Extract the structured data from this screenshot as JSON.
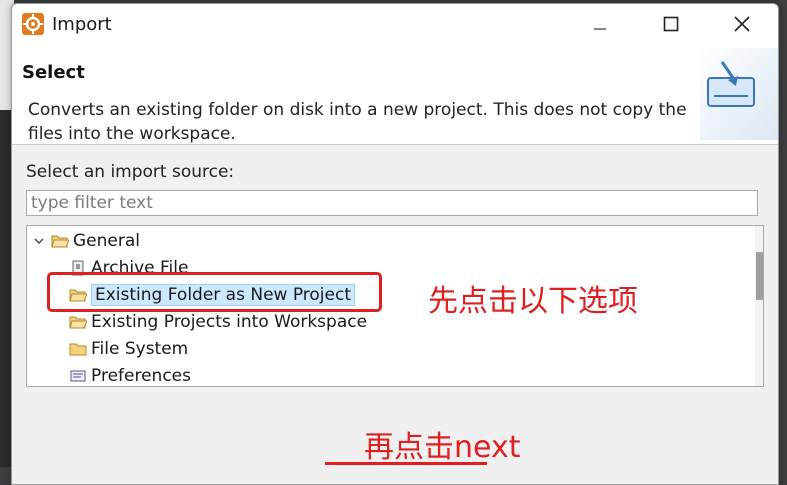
{
  "window": {
    "title": "Import",
    "controls": [
      "minimize",
      "maximize",
      "close"
    ]
  },
  "header": {
    "title": "Select",
    "description": "Converts an existing folder on disk into a new project. This does not copy the files into the workspace."
  },
  "source": {
    "label": "Select an import source:",
    "filter_placeholder": "type filter text",
    "filter_value": ""
  },
  "tree": {
    "group": {
      "label": "General",
      "expanded": true,
      "icon": "open-folder-icon"
    },
    "items": [
      {
        "label": "Archive File",
        "icon": "archive-icon",
        "selected": false
      },
      {
        "label": "Existing Folder as New Project",
        "icon": "open-folder-icon",
        "selected": true
      },
      {
        "label": "Existing Projects into Workspace",
        "icon": "open-folder-icon",
        "selected": false
      },
      {
        "label": "File System",
        "icon": "folder-icon",
        "selected": false
      },
      {
        "label": "Preferences",
        "icon": "preferences-icon",
        "selected": false
      }
    ]
  },
  "annotations": {
    "step1": "先点击以下选项",
    "step2": "再点击next",
    "color": "#e02020"
  },
  "colors": {
    "selection_bg": "#cce8ff",
    "selection_border": "#99d1ff"
  }
}
